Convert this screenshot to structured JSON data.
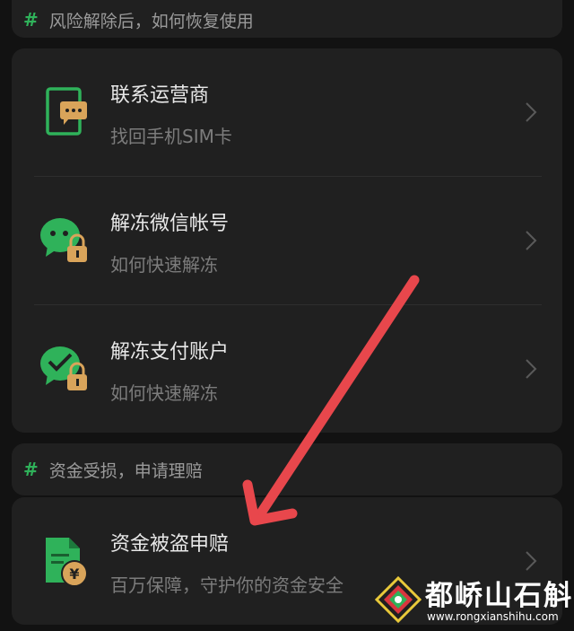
{
  "section1": {
    "header": "风险解除后，如何恢复使用",
    "items": [
      {
        "title": "联系运营商",
        "subtitle": "找回手机SIM卡",
        "icon": "phone-chat-icon"
      },
      {
        "title": "解冻微信帐号",
        "subtitle": "如何快速解冻",
        "icon": "wechat-lock-icon"
      },
      {
        "title": "解冻支付账户",
        "subtitle": "如何快速解冻",
        "icon": "pay-lock-icon"
      }
    ]
  },
  "section2": {
    "header": "资金受损，申请理赔",
    "items": [
      {
        "title": "资金被盗申赔",
        "subtitle": "百万保障，守护你的资金安全",
        "icon": "yuan-document-icon"
      }
    ]
  },
  "watermark": {
    "name": "都峤山石斛",
    "url": "www.rongxianshihu.com"
  },
  "colors": {
    "accent": "#2fb25a",
    "arrow": "#e8474c",
    "lock": "#d9a45a",
    "background": "#121212",
    "card": "#202020"
  }
}
